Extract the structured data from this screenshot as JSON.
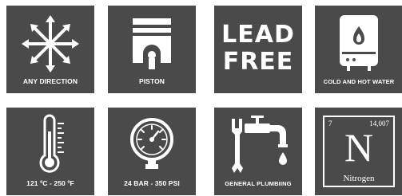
{
  "colors": {
    "tile_background": "#4a4a4a",
    "foreground": "#ffffff"
  },
  "features": [
    {
      "label": "ANY DIRECTION",
      "icon": "arrows-all-directions-icon"
    },
    {
      "label": "PISTON",
      "icon": "piston-icon"
    },
    {
      "label": "LEAD FREE",
      "line1": "LEAD",
      "line2": "FREE",
      "icon": "lead-free-text"
    },
    {
      "label": "COLD AND HOT WATER",
      "icon": "water-heater-icon"
    },
    {
      "label": "121 ºC - 250 ºF",
      "icon": "thermometer-icon"
    },
    {
      "label": "24 BAR - 350 PSI",
      "icon": "pressure-gauge-icon"
    },
    {
      "label": "GENERAL PLUMBIING",
      "icon": "faucet-wrench-icon"
    },
    {
      "label": "Nitrogen",
      "icon": "periodic-element-icon",
      "element": {
        "number": "7",
        "mass": "14,007",
        "symbol": "N",
        "name": "Nitrogen"
      }
    }
  ]
}
